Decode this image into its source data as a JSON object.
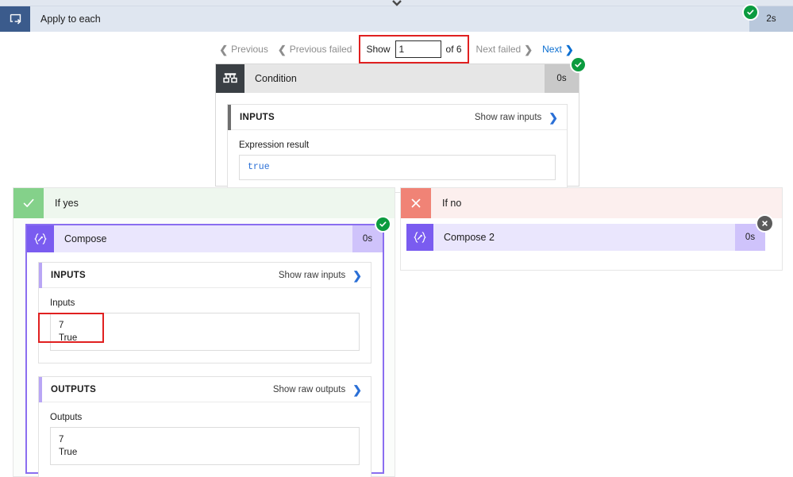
{
  "window": {
    "loop": {
      "icon": "apply-to-each-loop-icon",
      "title": "Apply to each",
      "duration": "2s",
      "status": "succeeded",
      "status_badge_glyph": "✓"
    },
    "top_chevron_icon": "chevron-down-icon"
  },
  "pager": {
    "previous_label": "Previous",
    "previous_failed_label": "Previous failed",
    "show_label": "Show",
    "show_value": "1",
    "show_placeholder": "",
    "of_label": "of 6",
    "total": 6,
    "next_failed_label": "Next failed",
    "next_label": "Next",
    "prev_chevron_icon": "chevron-left-icon",
    "next_chevron_icon": "chevron-right-icon",
    "highlight_color": "#e02020"
  },
  "condition": {
    "icon": "condition-branch-icon",
    "title": "Condition",
    "duration": "0s",
    "status": "succeeded",
    "status_badge_glyph": "✓",
    "inputs": {
      "section_title": "INPUTS",
      "raw_link": "Show raw inputs",
      "raw_chevron_icon": "chevron-right-icon",
      "field_label": "Expression result",
      "field_value": "true"
    }
  },
  "branches": {
    "yes": {
      "label": "If yes",
      "icon": "checkmark-icon",
      "icon_color": "#84d18a"
    },
    "no": {
      "label": "If no",
      "icon": "close-x-icon",
      "icon_color": "#f08376"
    }
  },
  "compose": {
    "icon": "compose-braces-icon",
    "title": "Compose",
    "duration": "0s",
    "status": "succeeded",
    "status_badge_glyph": "✓",
    "inputs": {
      "section_title": "INPUTS",
      "raw_link": "Show raw inputs",
      "raw_chevron_icon": "chevron-right-icon",
      "field_label": "Inputs",
      "field_value": "7\nTrue",
      "highlighted": true
    },
    "outputs": {
      "section_title": "OUTPUTS",
      "raw_link": "Show raw outputs",
      "raw_chevron_icon": "chevron-right-icon",
      "field_label": "Outputs",
      "field_value": "7\nTrue"
    }
  },
  "compose2": {
    "icon": "compose-braces-icon",
    "title": "Compose 2",
    "duration": "0s",
    "status": "skipped",
    "status_badge_glyph": "✕"
  },
  "colors": {
    "accent_purple": "#7a5cf0",
    "success_green": "#0b9b3f",
    "skipped_gray": "#5b5b5b",
    "link_blue": "#0a6ed1",
    "highlight_red": "#e02020",
    "loop_header_blue": "#dfe6f0"
  }
}
